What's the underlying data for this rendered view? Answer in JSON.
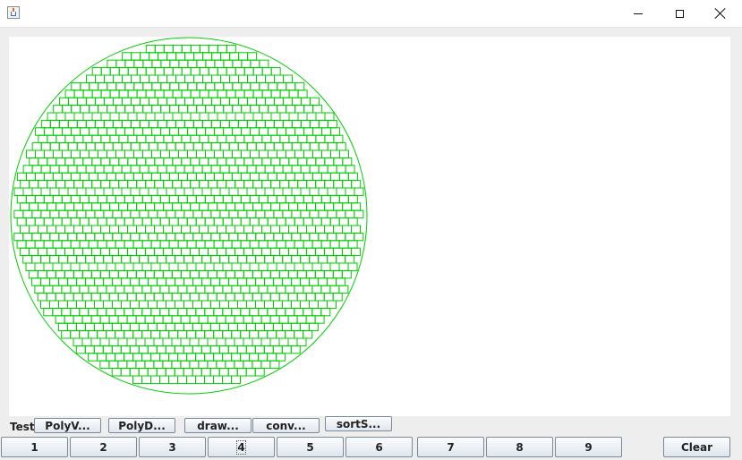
{
  "window": {
    "icon": "java-cup-icon",
    "controls": [
      "minimize-icon",
      "maximize-icon",
      "close-icon"
    ]
  },
  "canvas": {
    "shape_color": "#00cc00",
    "background": "#ffffff",
    "content": "green circle filled with a grid of small green rectangles"
  },
  "toolbar": {
    "label": "Test",
    "buttons": [
      "PolyV...",
      "PolyD...",
      "draw...",
      "conv...",
      "sortS..."
    ]
  },
  "bottom_bar": {
    "buttons": [
      "1",
      "2",
      "3",
      "4",
      "5",
      "6",
      "7",
      "8",
      "9"
    ],
    "focused": "4",
    "clear_label": "Clear"
  }
}
